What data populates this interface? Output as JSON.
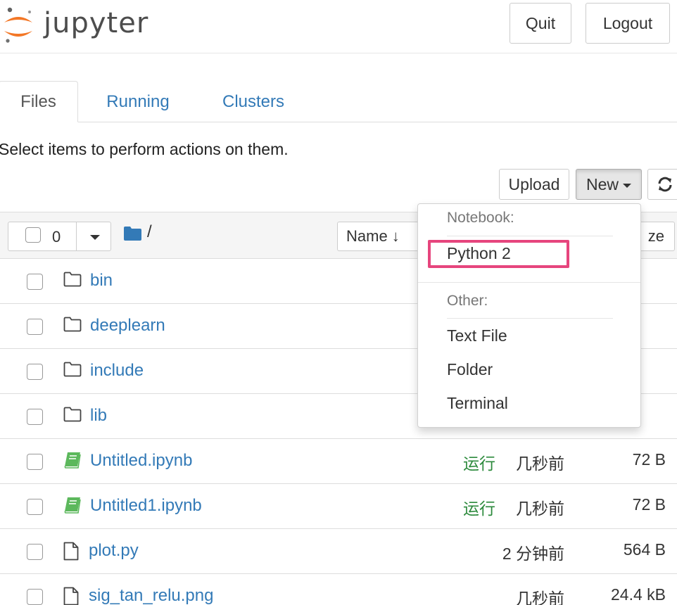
{
  "header": {
    "logo_text": "jupyter",
    "quit_label": "Quit",
    "logout_label": "Logout",
    "logo_colors": {
      "orange": "#f37726",
      "gray": "#616262"
    }
  },
  "tabs": [
    {
      "label": "Files",
      "active": true
    },
    {
      "label": "Running",
      "active": false
    },
    {
      "label": "Clusters",
      "active": false
    }
  ],
  "hint_text": "Select items to perform actions on them.",
  "toolbar": {
    "upload_label": "Upload",
    "new_label": "New",
    "refresh_icon": "refresh-icon"
  },
  "list_header": {
    "selected_count": "0",
    "breadcrumb": "/",
    "sort_name_label": "Name",
    "sort_size_label": "ze"
  },
  "files": [
    {
      "name": "bin",
      "type": "folder",
      "status": "",
      "modified": "",
      "size": ""
    },
    {
      "name": "deeplearn",
      "type": "folder",
      "status": "",
      "modified": "",
      "size": ""
    },
    {
      "name": "include",
      "type": "folder",
      "status": "",
      "modified": "",
      "size": ""
    },
    {
      "name": "lib",
      "type": "folder",
      "status": "",
      "modified": "",
      "size": ""
    },
    {
      "name": "Untitled.ipynb",
      "type": "notebook",
      "status": "运行",
      "modified": "几秒前",
      "size": "72 B"
    },
    {
      "name": "Untitled1.ipynb",
      "type": "notebook",
      "status": "运行",
      "modified": "几秒前",
      "size": "72 B"
    },
    {
      "name": "plot.py",
      "type": "file",
      "status": "",
      "modified": "2 分钟前",
      "size": "564 B"
    },
    {
      "name": "sig_tan_relu.png",
      "type": "file",
      "status": "",
      "modified": "几秒前",
      "size": "24.4 kB"
    }
  ],
  "new_menu": {
    "notebook_header": "Notebook:",
    "python2_label": "Python 2",
    "other_header": "Other:",
    "text_file_label": "Text File",
    "folder_label": "Folder",
    "terminal_label": "Terminal",
    "highlight_color": "#e6457d"
  },
  "colors": {
    "link": "#337ab7",
    "running": "#2c8a3c",
    "notebook_icon": "#5cb85c",
    "folder_icon_header": "#337ab7"
  }
}
